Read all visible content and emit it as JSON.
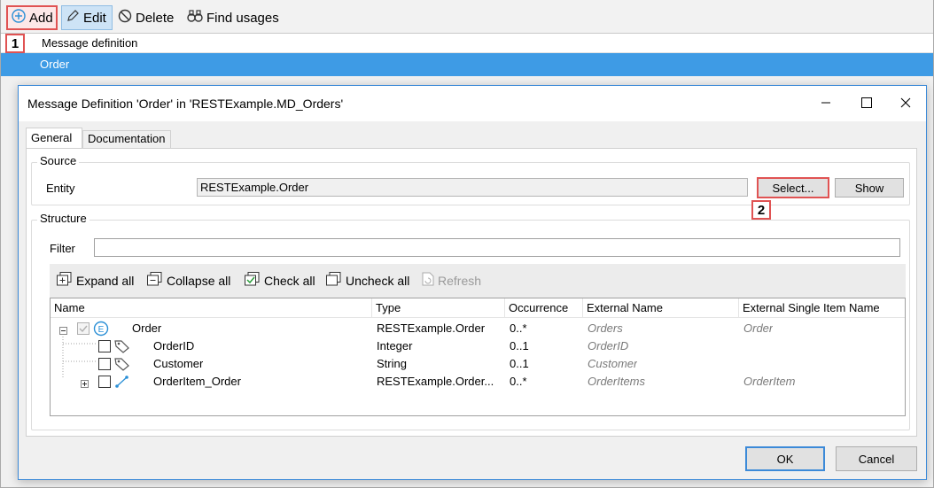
{
  "toolbar": {
    "add": "Add",
    "edit": "Edit",
    "delete": "Delete",
    "find_usages": "Find usages"
  },
  "badges": {
    "one": "1",
    "two": "2"
  },
  "list": {
    "header": "Message definition",
    "rows": [
      "Order"
    ]
  },
  "dialog": {
    "title": "Message Definition 'Order' in 'RESTExample.MD_Orders'",
    "tabs": [
      "General",
      "Documentation"
    ],
    "source": {
      "title": "Source",
      "entity_label": "Entity",
      "entity_value": "RESTExample.Order",
      "select_label": "Select...",
      "show_label": "Show"
    },
    "structure": {
      "title": "Structure",
      "filter_label": "Filter",
      "filter_value": "",
      "toolbar": {
        "expand_all": "Expand all",
        "collapse_all": "Collapse all",
        "check_all": "Check all",
        "uncheck_all": "Uncheck all",
        "refresh": "Refresh"
      },
      "columns": [
        "Name",
        "Type",
        "Occurrence",
        "External Name",
        "External Single Item Name"
      ],
      "rows": [
        {
          "name": "Order",
          "type": "RESTExample.Order",
          "occurrence": "0..*",
          "external_name": "Orders",
          "single_item": "Order"
        },
        {
          "name": "OrderID",
          "type": "Integer",
          "occurrence": "0..1",
          "external_name": "OrderID",
          "single_item": ""
        },
        {
          "name": "Customer",
          "type": "String",
          "occurrence": "0..1",
          "external_name": "Customer",
          "single_item": ""
        },
        {
          "name": "OrderItem_Order",
          "type": "RESTExample.Order...",
          "occurrence": "0..*",
          "external_name": "OrderItems",
          "single_item": "OrderItem"
        }
      ]
    },
    "ok_label": "OK",
    "cancel_label": "Cancel"
  },
  "colors": {
    "accent": "#3c8ad8",
    "selected_row": "#3e9be5",
    "highlight_red": "#e05353",
    "entity_icon": "#2a8fd6"
  }
}
